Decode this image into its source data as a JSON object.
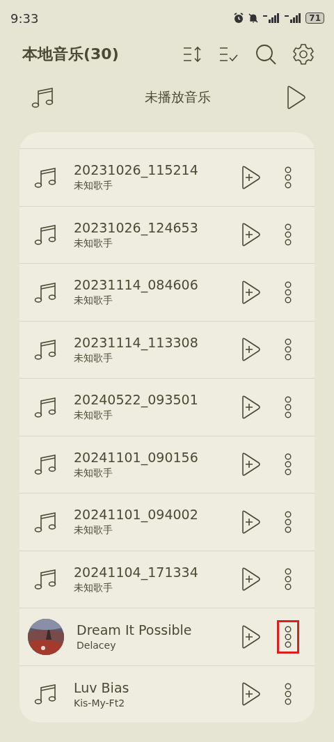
{
  "status_bar": {
    "time": "9:33",
    "battery": "71"
  },
  "header": {
    "title": "本地音乐(30)"
  },
  "unplayed": {
    "label": "未播放音乐"
  },
  "songs": [
    {
      "kind": "note",
      "title": "20231026_115214",
      "artist": "未知歌手",
      "highlighted": false
    },
    {
      "kind": "note",
      "title": "20231026_124653",
      "artist": "未知歌手",
      "highlighted": false
    },
    {
      "kind": "note",
      "title": "20231114_084606",
      "artist": "未知歌手",
      "highlighted": false
    },
    {
      "kind": "note",
      "title": "20231114_113308",
      "artist": "未知歌手",
      "highlighted": false
    },
    {
      "kind": "note",
      "title": "20240522_093501",
      "artist": "未知歌手",
      "highlighted": false
    },
    {
      "kind": "note",
      "title": "20241101_090156",
      "artist": "未知歌手",
      "highlighted": false
    },
    {
      "kind": "note",
      "title": "20241101_094002",
      "artist": "未知歌手",
      "highlighted": false
    },
    {
      "kind": "note",
      "title": "20241104_171334",
      "artist": "未知歌手",
      "highlighted": false
    },
    {
      "kind": "picture",
      "title": "Dream It Possible",
      "artist": "Delacey",
      "highlighted": true
    },
    {
      "kind": "note",
      "title": "Luv Bias",
      "artist": "Kis-My-Ft2",
      "highlighted": false
    }
  ]
}
